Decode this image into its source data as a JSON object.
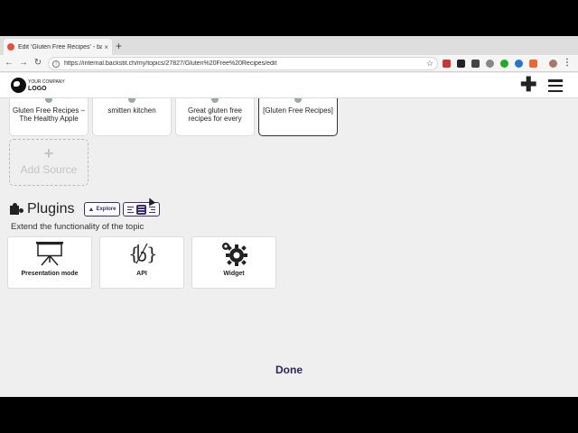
{
  "browser": {
    "tab_title": "Edit 'Gluten Free Recipes' - ba",
    "tab_close": "×",
    "new_tab": "+",
    "url": "https://internal.backstit.ch/my/topics/27827/Gluten%20Free%20Recipes/edit",
    "back": "←",
    "forward": "→",
    "reload": "↻",
    "bookmark_icon": "☆"
  },
  "header": {
    "logo_small": "YOUR COMPANY",
    "logo_big": "LOGO",
    "plus": "✚"
  },
  "sources": [
    {
      "label": "Gluten Free Recipes – The Healthy Apple"
    },
    {
      "label": "smitten kitchen"
    },
    {
      "label": "Great gluten free recipes for every"
    },
    {
      "label": "[Gluten Free Recipes]"
    }
  ],
  "add_source": {
    "plus": "+",
    "label": "Add Source"
  },
  "plugins": {
    "title": "Plugins",
    "explore_label": "Explore",
    "explore_icon": "▲",
    "description": "Extend the functionality of the topic",
    "items": [
      {
        "label": "Presentation mode",
        "icon": "presentation-icon"
      },
      {
        "label": "API",
        "icon": "api-icon"
      },
      {
        "label": "Widget",
        "icon": "gear-icon"
      }
    ]
  },
  "footer": {
    "done_label": "Done"
  },
  "colors": {
    "accent": "#3b2f6b",
    "done": "#2e2557"
  }
}
